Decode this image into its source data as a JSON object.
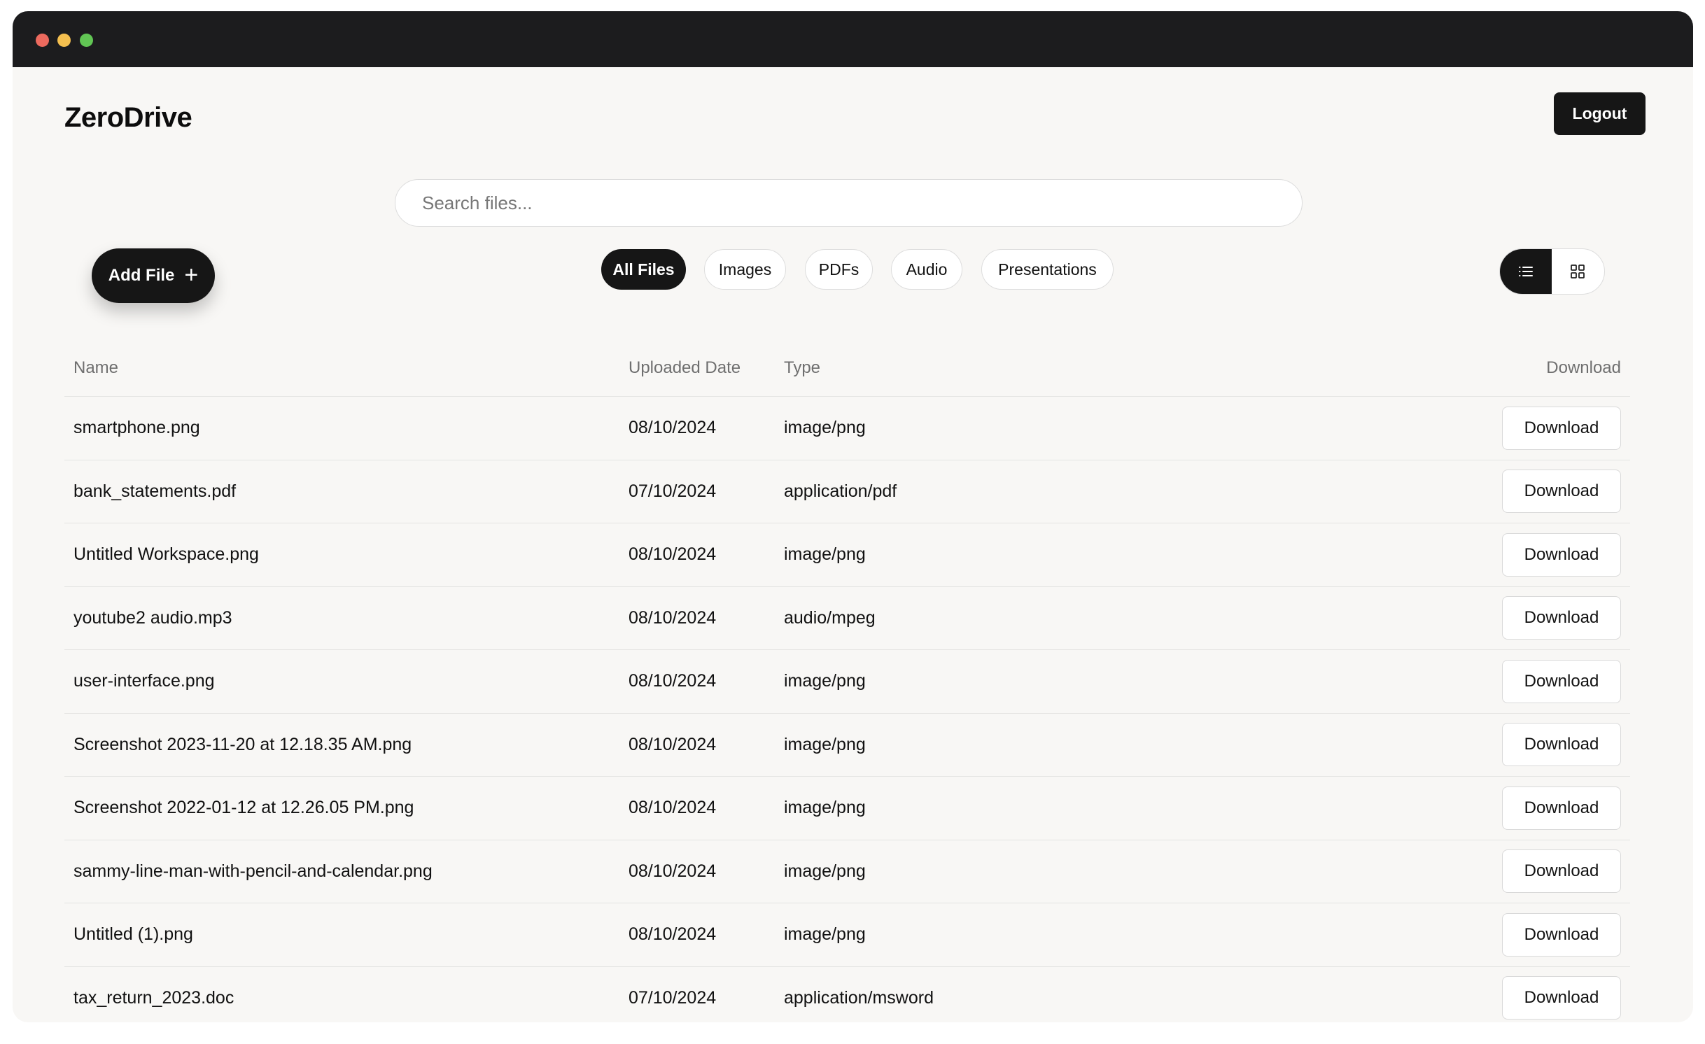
{
  "app": {
    "title": "ZeroDrive"
  },
  "header": {
    "logout_label": "Logout"
  },
  "search": {
    "placeholder": "Search files...",
    "value": ""
  },
  "actions": {
    "add_file_label": "Add File"
  },
  "filters": {
    "items": [
      "All Files",
      "Images",
      "PDFs",
      "Audio",
      "Presentations"
    ],
    "active": "All Files"
  },
  "view_toggle": {
    "options": [
      "list-icon",
      "grid-icon"
    ],
    "active": "list"
  },
  "table": {
    "columns": {
      "name": "Name",
      "date": "Uploaded Date",
      "type": "Type",
      "download": "Download"
    },
    "download_label": "Download",
    "rows": [
      {
        "name": "smartphone.png",
        "date": "08/10/2024",
        "type": "image/png"
      },
      {
        "name": "bank_statements.pdf",
        "date": "07/10/2024",
        "type": "application/pdf"
      },
      {
        "name": "Untitled Workspace.png",
        "date": "08/10/2024",
        "type": "image/png"
      },
      {
        "name": "youtube2 audio.mp3",
        "date": "08/10/2024",
        "type": "audio/mpeg"
      },
      {
        "name": "user-interface.png",
        "date": "08/10/2024",
        "type": "image/png"
      },
      {
        "name": "Screenshot 2023-11-20 at 12.18.35 AM.png",
        "date": "08/10/2024",
        "type": "image/png"
      },
      {
        "name": "Screenshot 2022-01-12 at 12.26.05 PM.png",
        "date": "08/10/2024",
        "type": "image/png"
      },
      {
        "name": "sammy-line-man-with-pencil-and-calendar.png",
        "date": "08/10/2024",
        "type": "image/png"
      },
      {
        "name": "Untitled (1).png",
        "date": "08/10/2024",
        "type": "image/png"
      },
      {
        "name": "tax_return_2023.doc",
        "date": "07/10/2024",
        "type": "application/msword"
      }
    ]
  },
  "colors": {
    "accent": "#161616",
    "background": "#f8f7f5",
    "titlebar": "#1c1c1e"
  }
}
